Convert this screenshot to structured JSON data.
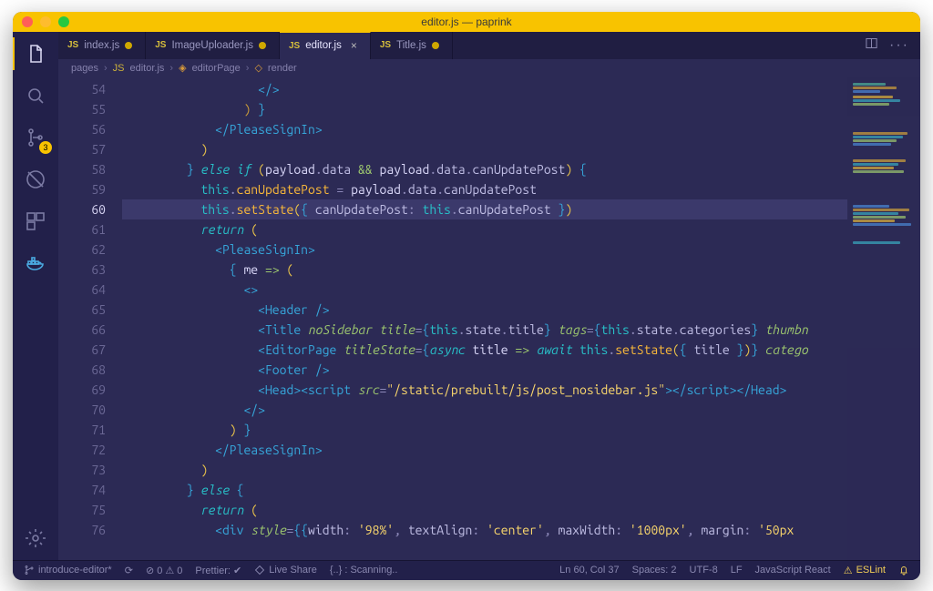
{
  "window": {
    "title": "editor.js — paprink"
  },
  "tabs": [
    {
      "label": "index.js",
      "active": false,
      "modified": true
    },
    {
      "label": "ImageUploader.js",
      "active": false,
      "modified": true
    },
    {
      "label": "editor.js",
      "active": true,
      "modified": false
    },
    {
      "label": "Title.js",
      "active": false,
      "modified": true
    }
  ],
  "breadcrumb": [
    {
      "label": "pages",
      "kind": "folder"
    },
    {
      "label": "editor.js",
      "kind": "file"
    },
    {
      "label": "editorPage",
      "kind": "symbol"
    },
    {
      "label": "render",
      "kind": "method"
    }
  ],
  "activity_badge": "3",
  "gutter": {
    "start": 54,
    "end": 76,
    "current": 60
  },
  "code_lines": [
    {
      "n": 54,
      "ind": 18,
      "tokens": [
        [
          "<",
          "tag"
        ],
        [
          "/>",
          "tag"
        ]
      ]
    },
    {
      "n": 55,
      "ind": 16,
      "tokens": [
        [
          ")",
          "br"
        ],
        [
          " ",
          ""
        ],
        [
          "}",
          "brblue"
        ]
      ]
    },
    {
      "n": 56,
      "ind": 12,
      "tokens": [
        [
          "</",
          "tag"
        ],
        [
          "PleaseSignIn",
          "tag"
        ],
        [
          ">",
          "tag"
        ]
      ]
    },
    {
      "n": 57,
      "ind": 10,
      "tokens": [
        [
          ")",
          "y"
        ]
      ]
    },
    {
      "n": 58,
      "ind": 8,
      "tokens": [
        [
          "}",
          "brblue"
        ],
        [
          " ",
          ""
        ],
        [
          "else if",
          "kw"
        ],
        [
          " ",
          ""
        ],
        [
          "(",
          "y"
        ],
        [
          "payload",
          "v"
        ],
        [
          ".",
          "op"
        ],
        [
          "data",
          "p"
        ],
        [
          " ",
          ""
        ],
        [
          "&&",
          "pn"
        ],
        [
          " ",
          ""
        ],
        [
          "payload",
          "v"
        ],
        [
          ".",
          "op"
        ],
        [
          "data",
          "p"
        ],
        [
          ".",
          "op"
        ],
        [
          "canUpdatePost",
          "p"
        ],
        [
          ")",
          "y"
        ],
        [
          " ",
          ""
        ],
        [
          "{",
          "brblue"
        ]
      ]
    },
    {
      "n": 59,
      "ind": 10,
      "tokens": [
        [
          "this",
          "kw2"
        ],
        [
          ".",
          "op"
        ],
        [
          "canUpdatePost",
          "fn"
        ],
        [
          " ",
          ""
        ],
        [
          "=",
          "op"
        ],
        [
          " ",
          ""
        ],
        [
          "payload",
          "v"
        ],
        [
          ".",
          "op"
        ],
        [
          "data",
          "p"
        ],
        [
          ".",
          "op"
        ],
        [
          "canUpdatePost",
          "p"
        ]
      ]
    },
    {
      "n": 60,
      "ind": 10,
      "hl": true,
      "tokens": [
        [
          "this",
          "kw2"
        ],
        [
          ".",
          "op"
        ],
        [
          "setState",
          "fn"
        ],
        [
          "(",
          "y"
        ],
        [
          "{",
          "brblue"
        ],
        [
          " ",
          ""
        ],
        [
          "canUpdatePost",
          "p"
        ],
        [
          ":",
          "op"
        ],
        [
          " ",
          ""
        ],
        [
          "this",
          "kw2"
        ],
        [
          ".",
          "op"
        ],
        [
          "canUpdatePost",
          "p"
        ],
        [
          " ",
          ""
        ],
        [
          "}",
          "brblue"
        ],
        [
          ")",
          "y"
        ]
      ]
    },
    {
      "n": 61,
      "ind": 10,
      "tokens": [
        [
          "return",
          "kw"
        ],
        [
          " ",
          ""
        ],
        [
          "(",
          "y"
        ]
      ]
    },
    {
      "n": 62,
      "ind": 12,
      "tokens": [
        [
          "<",
          "tag"
        ],
        [
          "PleaseSignIn",
          "tag"
        ],
        [
          ">",
          "tag"
        ]
      ]
    },
    {
      "n": 63,
      "ind": 14,
      "tokens": [
        [
          "{",
          "brblue"
        ],
        [
          " ",
          ""
        ],
        [
          "me",
          "v"
        ],
        [
          " ",
          ""
        ],
        [
          "=>",
          "pn"
        ],
        [
          " ",
          ""
        ],
        [
          "(",
          "y"
        ]
      ]
    },
    {
      "n": 64,
      "ind": 16,
      "tokens": [
        [
          "<>",
          "tag"
        ]
      ]
    },
    {
      "n": 65,
      "ind": 18,
      "tokens": [
        [
          "<",
          "tag"
        ],
        [
          "Header",
          "tag"
        ],
        [
          " ",
          ""
        ],
        [
          "/>",
          "tag"
        ]
      ]
    },
    {
      "n": 66,
      "ind": 18,
      "tokens": [
        [
          "<",
          "tag"
        ],
        [
          "Title",
          "tag"
        ],
        [
          " ",
          ""
        ],
        [
          "noSidebar",
          "attr"
        ],
        [
          " ",
          ""
        ],
        [
          "title",
          "attr"
        ],
        [
          "=",
          "op"
        ],
        [
          "{",
          "brblue"
        ],
        [
          "this",
          "kw2"
        ],
        [
          ".",
          "op"
        ],
        [
          "state",
          "p"
        ],
        [
          ".",
          "op"
        ],
        [
          "title",
          "p"
        ],
        [
          "}",
          "brblue"
        ],
        [
          " ",
          ""
        ],
        [
          "tags",
          "attr"
        ],
        [
          "=",
          "op"
        ],
        [
          "{",
          "brblue"
        ],
        [
          "this",
          "kw2"
        ],
        [
          ".",
          "op"
        ],
        [
          "state",
          "p"
        ],
        [
          ".",
          "op"
        ],
        [
          "categories",
          "p"
        ],
        [
          "}",
          "brblue"
        ],
        [
          " ",
          ""
        ],
        [
          "thumbn",
          "attr"
        ]
      ]
    },
    {
      "n": 67,
      "ind": 18,
      "tokens": [
        [
          "<",
          "tag"
        ],
        [
          "EditorPage",
          "tag"
        ],
        [
          " ",
          ""
        ],
        [
          "titleState",
          "attr"
        ],
        [
          "=",
          "op"
        ],
        [
          "{",
          "brblue"
        ],
        [
          "async",
          "kw"
        ],
        [
          " ",
          ""
        ],
        [
          "title",
          "v"
        ],
        [
          " ",
          ""
        ],
        [
          "=>",
          "pn"
        ],
        [
          " ",
          ""
        ],
        [
          "await",
          "kw"
        ],
        [
          " ",
          ""
        ],
        [
          "this",
          "kw2"
        ],
        [
          ".",
          "op"
        ],
        [
          "setState",
          "fn"
        ],
        [
          "(",
          "y"
        ],
        [
          "{",
          "brblue"
        ],
        [
          " ",
          ""
        ],
        [
          "title",
          "p"
        ],
        [
          " ",
          ""
        ],
        [
          "}",
          "brblue"
        ],
        [
          ")",
          "y"
        ],
        [
          "}",
          "brblue"
        ],
        [
          " ",
          ""
        ],
        [
          "catego",
          "attr"
        ]
      ]
    },
    {
      "n": 68,
      "ind": 18,
      "tokens": [
        [
          "<",
          "tag"
        ],
        [
          "Footer",
          "tag"
        ],
        [
          " ",
          ""
        ],
        [
          "/>",
          "tag"
        ]
      ]
    },
    {
      "n": 69,
      "ind": 18,
      "tokens": [
        [
          "<",
          "tag"
        ],
        [
          "Head",
          "tag"
        ],
        [
          ">",
          "tag"
        ],
        [
          "<",
          "tag"
        ],
        [
          "script",
          "tag"
        ],
        [
          " ",
          ""
        ],
        [
          "src",
          "attr"
        ],
        [
          "=",
          "op"
        ],
        [
          "\"/static/prebuilt/js/post_nosidebar.js\"",
          "str"
        ],
        [
          ">",
          "tag"
        ],
        [
          "</",
          "tag"
        ],
        [
          "script",
          "tag"
        ],
        [
          ">",
          "tag"
        ],
        [
          "</",
          "tag"
        ],
        [
          "Head",
          "tag"
        ],
        [
          ">",
          "tag"
        ]
      ]
    },
    {
      "n": 70,
      "ind": 16,
      "tokens": [
        [
          "</>",
          "tag"
        ]
      ]
    },
    {
      "n": 71,
      "ind": 14,
      "tokens": [
        [
          ")",
          "y"
        ],
        [
          " ",
          ""
        ],
        [
          "}",
          "brblue"
        ]
      ]
    },
    {
      "n": 72,
      "ind": 12,
      "tokens": [
        [
          "</",
          "tag"
        ],
        [
          "PleaseSignIn",
          "tag"
        ],
        [
          ">",
          "tag"
        ]
      ]
    },
    {
      "n": 73,
      "ind": 10,
      "tokens": [
        [
          ")",
          "y"
        ]
      ]
    },
    {
      "n": 74,
      "ind": 8,
      "tokens": [
        [
          "}",
          "brblue"
        ],
        [
          " ",
          ""
        ],
        [
          "else",
          "kw"
        ],
        [
          " ",
          ""
        ],
        [
          "{",
          "brblue"
        ]
      ]
    },
    {
      "n": 75,
      "ind": 10,
      "tokens": [
        [
          "return",
          "kw"
        ],
        [
          " ",
          ""
        ],
        [
          "(",
          "y"
        ]
      ]
    },
    {
      "n": 76,
      "ind": 12,
      "tokens": [
        [
          "<",
          "tag"
        ],
        [
          "div",
          "tag"
        ],
        [
          " ",
          ""
        ],
        [
          "style",
          "attr"
        ],
        [
          "=",
          "op"
        ],
        [
          "{{",
          "brblue"
        ],
        [
          "width",
          "p"
        ],
        [
          ":",
          "op"
        ],
        [
          " ",
          ""
        ],
        [
          "'98%'",
          "str"
        ],
        [
          ",",
          "op"
        ],
        [
          " ",
          ""
        ],
        [
          "textAlign",
          "p"
        ],
        [
          ":",
          "op"
        ],
        [
          " ",
          ""
        ],
        [
          "'center'",
          "str"
        ],
        [
          ",",
          "op"
        ],
        [
          " ",
          ""
        ],
        [
          "maxWidth",
          "p"
        ],
        [
          ":",
          "op"
        ],
        [
          " ",
          ""
        ],
        [
          "'1000px'",
          "str"
        ],
        [
          ",",
          "op"
        ],
        [
          " ",
          ""
        ],
        [
          "margin",
          "p"
        ],
        [
          ":",
          "op"
        ],
        [
          " ",
          ""
        ],
        [
          "'50px",
          "str"
        ]
      ]
    }
  ],
  "status": {
    "branch": "introduce-editor*",
    "sync": "⟳",
    "problems": "⊘ 0 ⚠ 0",
    "prettier": "Prettier: ✔",
    "liveshare": "Live Share",
    "scanning": "{..} : Scanning..",
    "cursor": "Ln 60, Col 37",
    "spaces": "Spaces: 2",
    "encoding": "UTF-8",
    "eol": "LF",
    "lang": "JavaScript React",
    "eslint": "ESLint",
    "eslint_icon": "⚠"
  }
}
